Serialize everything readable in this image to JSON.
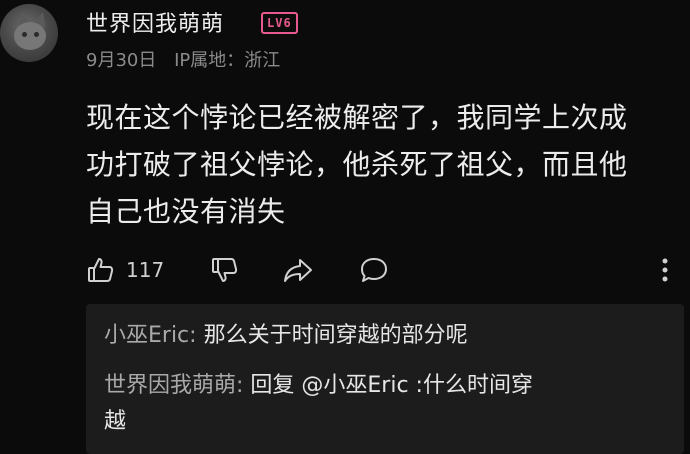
{
  "comment": {
    "username": "世界因我萌萌",
    "level_badge": "LV6",
    "date": "9月30日",
    "ip_location": "IP属地：浙江",
    "text_lines": [
      "现在这个悖论已经被解密了，我同学上次成",
      "功打破了祖父悖论，他杀死了祖父，而且他",
      "自己也没有消失"
    ],
    "like_count": "117",
    "icons": {
      "like": "thumbs-up-icon",
      "dislike": "thumbs-down-icon",
      "share": "share-icon",
      "reply": "comment-bubble-icon",
      "more": "more-vertical-icon"
    }
  },
  "replies": [
    {
      "name": "小巫Eric:",
      "text": " 那么关于时间穿越的部分呢"
    },
    {
      "name": "世界因我萌萌:",
      "text": " 回复 @小巫Eric :什么时间穿",
      "continuation": "越"
    }
  ],
  "colors": {
    "background": "#0b0b0b",
    "badge": "#e75a8f",
    "reply_box": "#1c1c1c",
    "meta_text": "#8a8a8a"
  }
}
